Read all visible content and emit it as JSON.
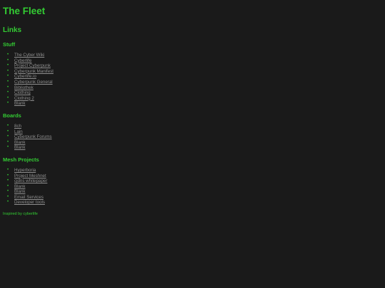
{
  "title": "The Fleet",
  "links_heading": "Links",
  "sections": [
    {
      "heading": "Stuff",
      "items": [
        "The Cyber Wiki",
        "Cyberlife",
        "Project Cyberpunk",
        "Cyberpunk Manifest",
        "Cyberlife.io",
        "Cyberpunk General",
        "Bibliothek",
        "Clothing",
        "Clothing 2",
        "Blank"
      ]
    },
    {
      "heading": "Boards",
      "items": [
        "8ch",
        "Lain",
        "Cyberpunk Forums",
        "Blank",
        "Blank"
      ]
    },
    {
      "heading": "Mesh Projects",
      "items": [
        "Hyperboria",
        "Project Meshnet",
        "cjdns whitepaper",
        "Blank",
        "Blank",
        "Email Services",
        "Developer tools"
      ]
    }
  ],
  "footer": "Inspired by cyberlife",
  "colors": {
    "background": "#1a1a1a",
    "heading": "#33cc33",
    "link": "#8f8f8f"
  }
}
